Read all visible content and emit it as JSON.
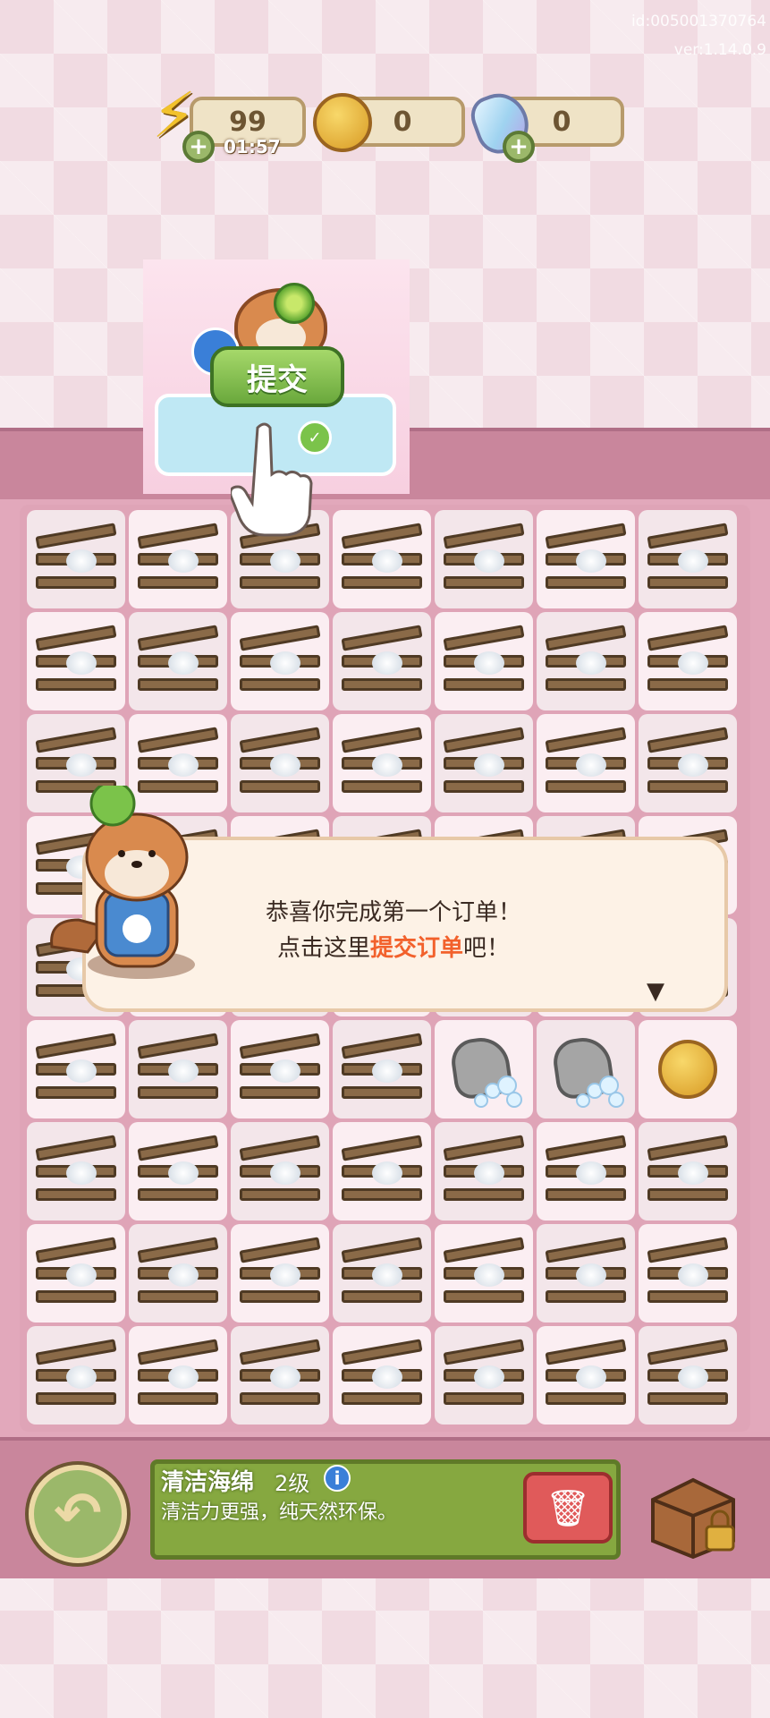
{
  "debug": {
    "id_text": "id:005001370764",
    "version_text": "ver:1.14.0.9"
  },
  "resources": {
    "energy": {
      "value": "99",
      "timer": "01:57",
      "icon": "lightning-icon"
    },
    "coins": {
      "value": "0",
      "icon": "coin-icon"
    },
    "gems": {
      "value": "0",
      "icon": "gem-icon"
    }
  },
  "tutorial": {
    "submit_label": "提交"
  },
  "dialog": {
    "line1": "恭喜你完成第一个订单！",
    "line2_prefix": "点击这里",
    "line2_highlight": "提交订单",
    "line2_suffix": "吧！",
    "continue_icon": "▼"
  },
  "board": {
    "rows": 9,
    "cols": 7,
    "special_cells": {
      "rock": [
        [
          5,
          4
        ],
        [
          5,
          5
        ]
      ],
      "coin": [
        [
          5,
          6
        ]
      ],
      "bolt": [
        [
          3,
          5
        ]
      ]
    }
  },
  "item_info": {
    "name": "清洁海绵",
    "level": "2级",
    "info_icon": "i",
    "description": "清洁力更强，纯天然环保。",
    "delete_icon": "🗑"
  },
  "colors": {
    "highlight": "#f2612c",
    "button_green": "#86a840",
    "board_pink": "#e2a8bb"
  }
}
